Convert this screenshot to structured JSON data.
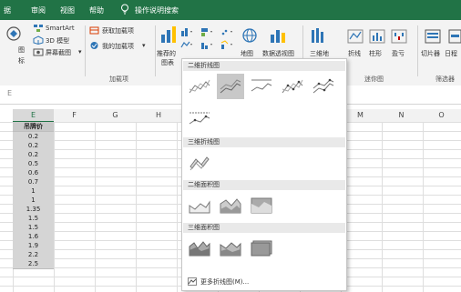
{
  "tabs": [
    "据",
    "审阅",
    "视图",
    "帮助",
    "操作说明搜索"
  ],
  "ribbon": {
    "smartart": "SmartArt",
    "model3d": "3D 模型",
    "screenshot": "屏幕截图",
    "left_fragments": [
      "图",
      "标"
    ],
    "get_addins": "获取加载项",
    "my_addins": "我的加载项",
    "addins_group": "加载项",
    "recommended_1": "推荐的",
    "recommended_2": "图表",
    "maps": "地图",
    "pivot_chart": "数据透视图",
    "map3d": "三维地",
    "sparkline_line": "折线",
    "sparkline_column": "柱形",
    "sparkline_winloss": "盈亏",
    "sparkline_group": "迷你图",
    "slicer": "切片器",
    "timeline": "日程",
    "filter_group": "筛选器"
  },
  "formula_bar": {
    "name_fragment": "E"
  },
  "columns": [
    "E",
    "F",
    "G",
    "H",
    "M",
    "N",
    "O"
  ],
  "cells": {
    "header": "吊牌价",
    "values": [
      "0.2",
      "0.2",
      "0.2",
      "0.5",
      "0.6",
      "0.7",
      "1",
      "1",
      "1.35",
      "1.5",
      "1.5",
      "1.6",
      "1.9",
      "2.2",
      "2.5"
    ]
  },
  "dropdown": {
    "sections": [
      "二维折线图",
      "三维折线图",
      "二维面积图",
      "三维面积图"
    ],
    "more_link": "更多折线图(M)..."
  },
  "colors": {
    "excel_green": "#217346",
    "highlight": "#c8c8c8"
  }
}
